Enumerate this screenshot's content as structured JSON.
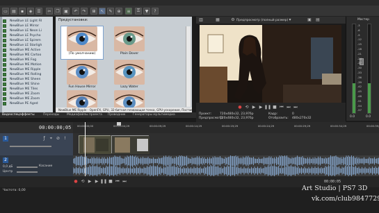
{
  "explorer": {
    "items": [
      "NewBlue LE Light Fil",
      "NewBlue LE Mirror",
      "NewBlue LE Neon Li",
      "NewBlue LE Psycho",
      "NewBlue LE Spirem",
      "NewBlue LE Starligh",
      "NewBlue ME Active",
      "NewBlue ME Cartoo",
      "NewBlue ME Fog",
      "NewBlue ME Motion",
      "NewBlue ME Ripple",
      "NewBlue ME Rolling",
      "NewBlue ME Sheen",
      "NewBlue ME Shine",
      "NewBlue ME Tiles",
      "NewBlue ME Zoom",
      "NewBlue ME Zoom",
      "NewBlue PE Aged"
    ]
  },
  "presets": {
    "title": "Предустановки:",
    "items": [
      {
        "label": "(По умолчанию)",
        "selected": true,
        "tint": "#4e88c8"
      },
      {
        "label": "Plain Dover",
        "selected": false,
        "tint": "#6a9a8a"
      },
      {
        "label": "Fun House Mirror",
        "selected": false,
        "tint": "#5c8ec6"
      },
      {
        "label": "Lazy Water",
        "selected": false,
        "tint": "#5a95c0"
      },
      {
        "label": "",
        "selected": false,
        "tint": "#557fb4"
      },
      {
        "label": "",
        "selected": false,
        "tint": "#5e8fc0"
      }
    ],
    "description": "NewBlue ME Ripple - OpenFX, GPU, 32-битная плавающая точка, GPU-ускорение, Поставщик: NewBlue"
  },
  "tabs": [
    "Видеоспецэффекты",
    "Переходы",
    "Медиафайлы проекта",
    "Проводник",
    "Генераторы мультимедиа"
  ],
  "preview": {
    "mode_label": "Предпросмотр (полный размер)",
    "project_label": "Проект:",
    "project_value": "720x480x32, 23,976p",
    "preview_label": "Предпросмотр:",
    "preview_value": "720x480x32, 23,976p",
    "frame_label": "Кадр:",
    "frame_value": "0",
    "display_label": "Отобразить:",
    "display_value": "480x270x32"
  },
  "mixer": {
    "title": "Мастер",
    "scale": [
      "-3",
      "-6",
      "-9",
      "-12",
      "-15",
      "-18",
      "-21",
      "-24",
      "-27",
      "-30",
      "-33",
      "-36",
      "-39",
      "-42",
      "-45",
      "-48",
      "-51",
      "-54",
      "-57"
    ],
    "value_left": "0.0",
    "value_right": "0.0"
  },
  "timeline": {
    "timecode": "00:00:00;05",
    "ruler": [
      "00:00:00;00",
      "00:00:04;29",
      "00:00:09;29",
      "00:00:14;29",
      "00:00:19;29",
      "00:00:24;29",
      "00:00:29;29",
      "00:00:34;29",
      "00:00:39;29"
    ],
    "audio_level": "0,0 дБ",
    "audio_pan": "Центр",
    "audio_pan_label": "Касание",
    "end_time": "00:00:05"
  },
  "status": {
    "rate": "Частота: 0,00"
  },
  "watermark": {
    "line1": "Art Studio | PS7 3D",
    "line2": "vk.com/club9847729"
  }
}
